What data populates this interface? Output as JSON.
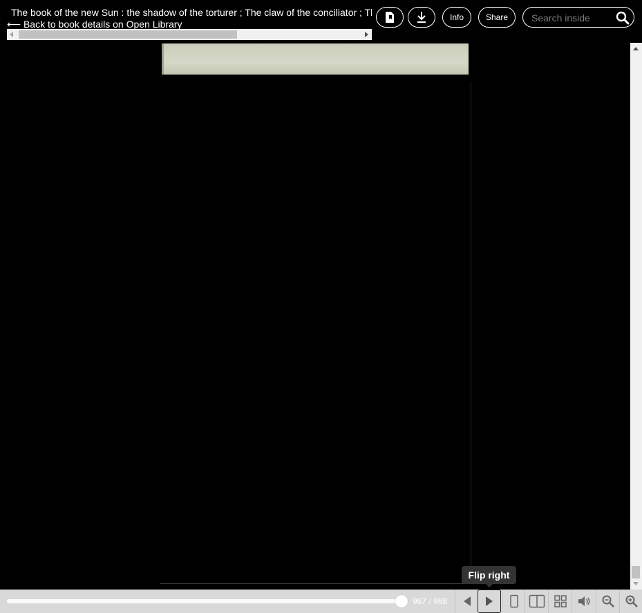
{
  "header": {
    "title": "The book of the new Sun : the shadow of the torturer ; The claw of the conciliator ; The sword of the lictor ; The citadel of the autarch",
    "back_link": "⟵ Back to book details on Open Library",
    "buttons": {
      "bookmark_icon": "bookmark-page-icon",
      "download_icon": "download-icon",
      "info_label": "Info",
      "share_label": "Share"
    },
    "search": {
      "placeholder": "Search inside",
      "value": "",
      "icon": "search-icon"
    }
  },
  "viewer": {
    "tooltip": "Flip right"
  },
  "toolbar": {
    "page_indicator": "967 / 968",
    "progress": 0.999,
    "icons": [
      "flip-left-icon",
      "flip-right-icon",
      "one-page-view-icon",
      "two-page-view-icon",
      "thumbnail-view-icon",
      "read-aloud-icon",
      "zoom-out-icon",
      "zoom-in-icon"
    ]
  },
  "colors": {
    "background": "#000000",
    "toolbar": "#d9d9d9",
    "tooltip": "#333333"
  }
}
